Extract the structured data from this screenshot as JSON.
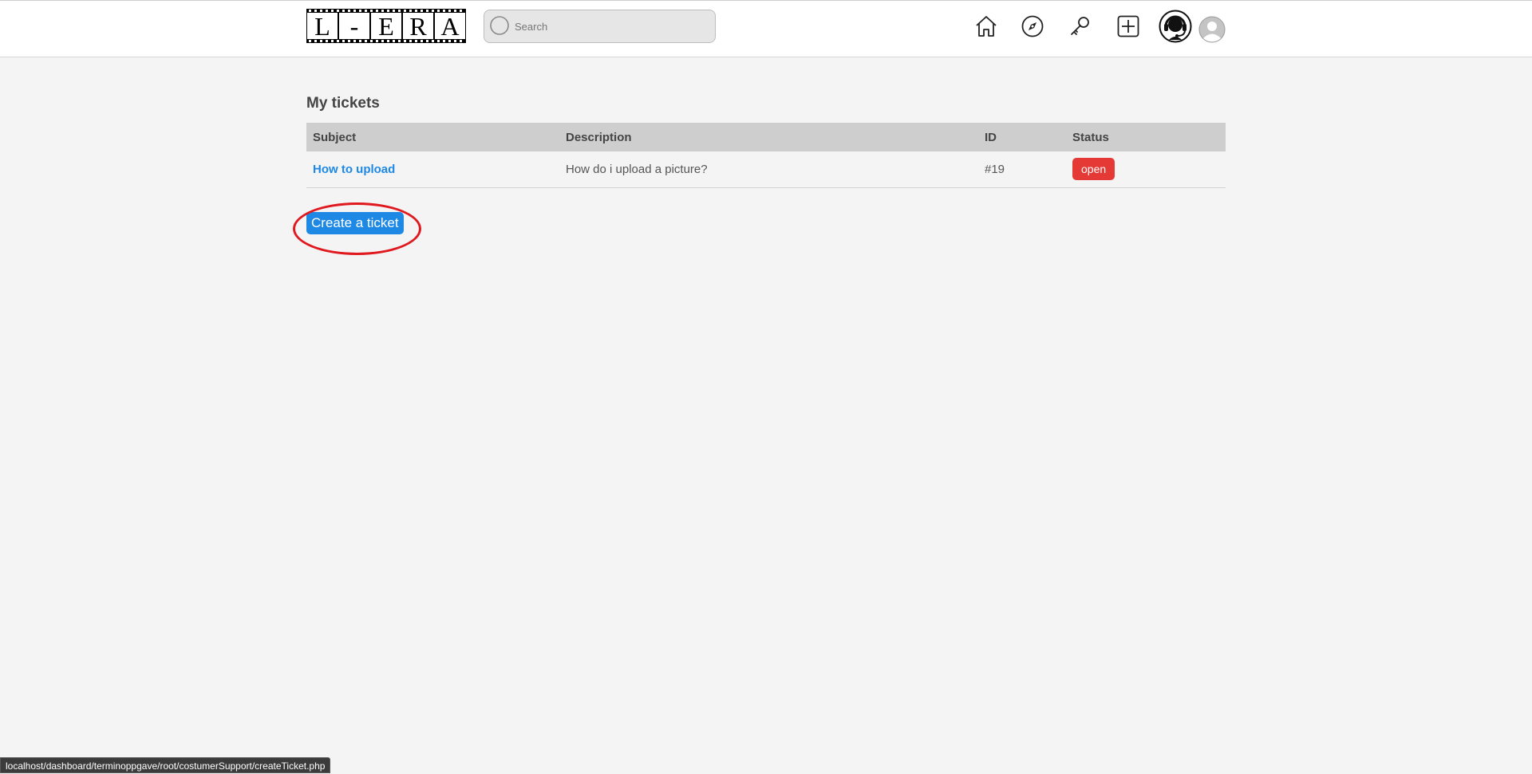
{
  "header": {
    "logo_text": "L-ERA",
    "search": {
      "placeholder": "Search",
      "value": ""
    },
    "nav": [
      {
        "name": "home-icon"
      },
      {
        "name": "compass-icon"
      },
      {
        "name": "key-icon"
      },
      {
        "name": "plus-square-icon"
      },
      {
        "name": "support-headset-icon"
      },
      {
        "name": "profile-avatar-icon"
      }
    ]
  },
  "main": {
    "title": "My tickets",
    "table": {
      "columns": [
        "Subject",
        "Description",
        "ID",
        "Status"
      ],
      "rows": [
        {
          "subject": "How to upload",
          "description": "How do i upload a picture?",
          "id": "#19",
          "status": "open"
        }
      ]
    },
    "create_button_label": "Create a ticket"
  },
  "status_bar": {
    "url": "localhost/dashboard/terminoppgave/root/costumerSupport/createTicket.php"
  },
  "colors": {
    "accent": "#1e88e5",
    "status_open": "#e53935",
    "highlight": "#e0191f"
  }
}
